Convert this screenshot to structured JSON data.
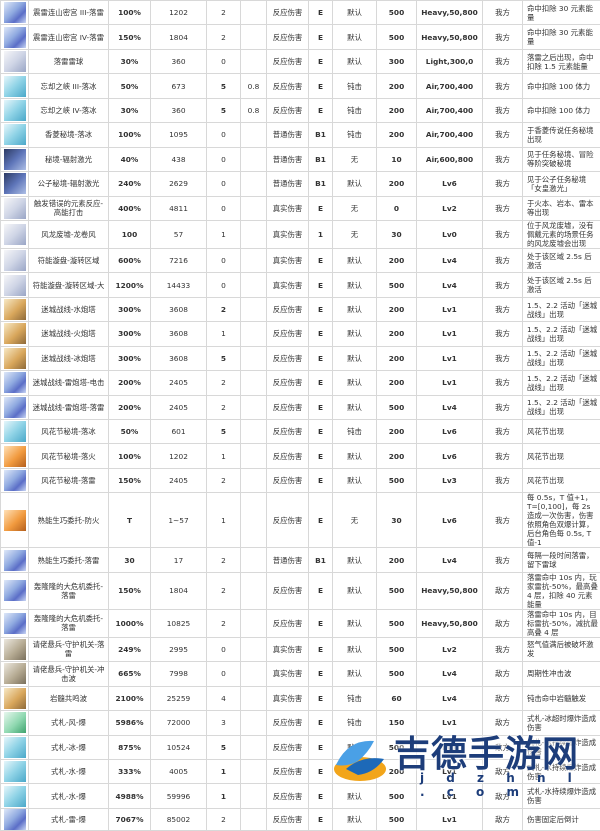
{
  "table": {
    "rows": [
      {
        "icon": "blue",
        "name": "震雷连山密宫 III-落雷",
        "pct": "100%",
        "val": "1202",
        "vc": "purple",
        "cnt": "2",
        "cc": "purple",
        "type": "反应伤害",
        "tc": "red",
        "ele": "E",
        "gauge": "默认",
        "dur": "500",
        "inf": "Heavy,50,800",
        "cat": "我方",
        "ci": "red",
        "desc": "命中扣除 30 元素能量"
      },
      {
        "icon": "blue",
        "name": "震雷连山密宫 IV-落雷",
        "pct": "150%",
        "val": "1804",
        "vc": "purple",
        "cnt": "2",
        "cc": "purple",
        "type": "反应伤害",
        "tc": "red",
        "ele": "E",
        "gauge": "默认",
        "dur": "500",
        "inf": "Heavy,50,800",
        "cat": "我方",
        "ci": "red",
        "desc": "命中扣除 30 元素能量"
      },
      {
        "icon": "white",
        "name": "落雷雷球",
        "pct": "30%",
        "val": "360",
        "vc": "purple",
        "cnt": "0",
        "cc": "purple",
        "type": "反应伤害",
        "tc": "red",
        "ele": "E",
        "gauge": "默认",
        "dur": "300",
        "inf": "Light,300,0",
        "cat": "我方",
        "ci": "red",
        "desc": "落雷之后出现，命中扣除 1.5 元素能量"
      },
      {
        "icon": "cyan",
        "name": "忘却之峡 III-落冰",
        "pct": "50%",
        "val": "673",
        "vc": "blue",
        "cnt": "5",
        "cc": "blue",
        "ins": "0.8",
        "type": "反应伤害",
        "tc": "red",
        "ele": "E",
        "gauge": "钝击",
        "dur": "200",
        "inf": "Air,700,400",
        "cat": "我方",
        "ci": "red",
        "desc": "命中扣除 100 体力"
      },
      {
        "icon": "cyan",
        "name": "忘却之峡 IV-落冰",
        "pct": "30%",
        "val": "360",
        "vc": "blue",
        "cnt": "5",
        "cc": "blue",
        "ins": "0.8",
        "type": "反应伤害",
        "tc": "red",
        "ele": "E",
        "gauge": "钝击",
        "dur": "200",
        "inf": "Air,700,400",
        "cat": "我方",
        "ci": "red",
        "desc": "命中扣除 100 体力"
      },
      {
        "icon": "cyan",
        "name": "香菱秘境-落冰",
        "pct": "100%",
        "val": "1095",
        "vc": "green",
        "cnt": "0",
        "cc": "green",
        "type": "普通伤害",
        "tc": "green",
        "ele": "B1",
        "gauge": "钝击",
        "dur": "200",
        "inf": "Air,700,400",
        "cat": "我方",
        "ci": "red",
        "desc": "于香菱传说任务秘境出现"
      },
      {
        "icon": "dark",
        "name": "秘境-辐射激光",
        "pct": "40%",
        "val": "438",
        "vc": "gray",
        "cnt": "0",
        "cc": "gray",
        "type": "普通伤害",
        "tc": "green",
        "ele": "B1",
        "gauge": "无",
        "dur": "10",
        "inf": "Air,600,800",
        "cat": "我方",
        "ci": "red",
        "desc": "见于任务秘境、冒险等阶突破秘境"
      },
      {
        "icon": "dark",
        "name": "公子秘境-辐射激光",
        "pct": "240%",
        "val": "2629",
        "vc": "gray",
        "cnt": "0",
        "cc": "gray",
        "type": "普通伤害",
        "tc": "green",
        "ele": "B1",
        "gauge": "默认",
        "dur": "200",
        "inf": "Lv6",
        "cat": "我方",
        "ci": "red",
        "desc": "见于公子任务秘境「女皇激光」"
      },
      {
        "icon": "white",
        "name": "触发错误的元素反应-高能打击",
        "pct": "400%",
        "val": "4811",
        "vc": "gray",
        "cnt": "0",
        "cc": "gray",
        "type": "真实伤害",
        "tc": "gray",
        "ele": "E",
        "gauge": "无",
        "dur": "0",
        "inf": "Lv2",
        "cat": "我方",
        "ci": "red",
        "desc": "于火本、岩本、雷本等出现"
      },
      {
        "icon": "white",
        "name": "风龙废墟-龙卷风",
        "pct": "100",
        "val": "57",
        "vc": "gray",
        "cnt": "1",
        "cc": "gray",
        "type": "真实伤害",
        "tc": "gray",
        "ele": "1",
        "gauge": "无",
        "dur": "30",
        "inf": "Lv0",
        "cat": "我方",
        "ci": "red",
        "desc": "位于风龙废墟，没有佩戴元素的场景任务的风龙废墟会出现"
      },
      {
        "icon": "white",
        "name": "符能漩盘-漩转区域",
        "pct": "600%",
        "val": "7216",
        "vc": "gray",
        "cnt": "0",
        "cc": "gray",
        "type": "真实伤害",
        "tc": "gray",
        "ele": "E",
        "gauge": "默认",
        "dur": "200",
        "inf": "Lv4",
        "cat": "我方",
        "ci": "red",
        "desc": "处于该区域 2.5s 后激活"
      },
      {
        "icon": "white",
        "name": "符能漩盘-漩转区域-大",
        "pct": "1200%",
        "val": "14433",
        "vc": "gray",
        "cnt": "0",
        "cc": "gray",
        "type": "真实伤害",
        "tc": "gray",
        "ele": "E",
        "gauge": "默认",
        "dur": "500",
        "inf": "Lv4",
        "cat": "我方",
        "ci": "red",
        "desc": "处于该区域 2.5s 后激活"
      },
      {
        "icon": "gold",
        "name": "迷城战线-水炮塔",
        "pct": "300%",
        "val": "3608",
        "vc": "blue",
        "cnt": "2",
        "cc": "blue",
        "type": "反应伤害",
        "tc": "red",
        "ele": "E",
        "gauge": "默认",
        "dur": "200",
        "inf": "Lv1",
        "cat": "我方",
        "ci": "red",
        "desc": "1.5、2.2 活动「迷城战线」出现"
      },
      {
        "icon": "gold",
        "name": "迷城战线-火炮塔",
        "pct": "300%",
        "val": "3608",
        "vc": "orange",
        "cnt": "1",
        "cc": "orange",
        "type": "反应伤害",
        "tc": "red",
        "ele": "E",
        "gauge": "默认",
        "dur": "200",
        "inf": "Lv1",
        "cat": "我方",
        "ci": "red",
        "desc": "1.5、2.2 活动「迷城战线」出现"
      },
      {
        "icon": "gold",
        "name": "迷城战线-冰炮塔",
        "pct": "300%",
        "val": "3608",
        "vc": "blue",
        "cnt": "5",
        "cc": "blue",
        "type": "反应伤害",
        "tc": "red",
        "ele": "E",
        "gauge": "默认",
        "dur": "200",
        "inf": "Lv1",
        "cat": "我方",
        "ci": "red",
        "desc": "1.5、2.2 活动「迷城战线」出现"
      },
      {
        "icon": "blue",
        "name": "迷城战线-雷炮塔-电击",
        "pct": "200%",
        "val": "2405",
        "vc": "purple",
        "cnt": "2",
        "cc": "purple",
        "type": "反应伤害",
        "tc": "red",
        "ele": "E",
        "gauge": "默认",
        "dur": "200",
        "inf": "Lv1",
        "cat": "我方",
        "ci": "red",
        "desc": "1.5、2.2 活动「迷城战线」出现"
      },
      {
        "icon": "blue",
        "name": "迷城战线-雷炮塔-落雷",
        "pct": "200%",
        "val": "2405",
        "vc": "purple",
        "cnt": "2",
        "cc": "purple",
        "type": "反应伤害",
        "tc": "red",
        "ele": "E",
        "gauge": "默认",
        "dur": "500",
        "inf": "Lv4",
        "cat": "我方",
        "ci": "red",
        "desc": "1.5、2.2 活动「迷城战线」出现"
      },
      {
        "icon": "cyan",
        "name": "风花节秘境-落冰",
        "pct": "50%",
        "val": "601",
        "vc": "blue",
        "cnt": "5",
        "cc": "blue",
        "type": "反应伤害",
        "tc": "red",
        "ele": "E",
        "gauge": "钝击",
        "dur": "200",
        "inf": "Lv6",
        "cat": "我方",
        "ci": "red",
        "desc": "风花节出现"
      },
      {
        "icon": "orange",
        "name": "风花节秘境-落火",
        "pct": "100%",
        "val": "1202",
        "vc": "orange",
        "cnt": "1",
        "cc": "orange",
        "type": "反应伤害",
        "tc": "red",
        "ele": "E",
        "gauge": "默认",
        "dur": "200",
        "inf": "Lv6",
        "cat": "我方",
        "ci": "red",
        "desc": "风花节出现"
      },
      {
        "icon": "blue",
        "name": "风花节秘境-落雷",
        "pct": "150%",
        "val": "2405",
        "vc": "purple",
        "cnt": "2",
        "cc": "purple",
        "type": "反应伤害",
        "tc": "red",
        "ele": "E",
        "gauge": "默认",
        "dur": "500",
        "inf": "Lv3",
        "cat": "我方",
        "ci": "red",
        "desc": "风花节出现"
      },
      {
        "icon": "orange",
        "name": "熟能生巧委托-防火",
        "pct": "T",
        "val": "1~57",
        "vc": "orange",
        "cnt": "1",
        "cc": "orange",
        "type": "反应伤害",
        "tc": "red",
        "ele": "E",
        "gauge": "无",
        "dur": "30",
        "inf": "Lv6",
        "cat": "我方",
        "ci": "red",
        "desc": "每 0.5s，T 值+1，T=[0,100]，每 2s 造成一次伤害，伤害依照角色双爆计算，后台角色每 0.5s, T 值-1"
      },
      {
        "icon": "blue",
        "name": "熟能生巧委托-落雷",
        "pct": "30",
        "val": "17",
        "vc": "purple",
        "cnt": "2",
        "cc": "purple",
        "type": "普通伤害",
        "tc": "green",
        "ele": "B1",
        "gauge": "默认",
        "dur": "200",
        "inf": "Lv4",
        "cat": "我方",
        "ci": "red",
        "desc": "每隔一段时间落雷，留下雷球"
      },
      {
        "icon": "blue",
        "name": "轰隆隆的大危机委托-落雷",
        "pct": "150%",
        "val": "1804",
        "vc": "purple",
        "cnt": "2",
        "cc": "purple",
        "type": "反应伤害",
        "tc": "red",
        "ele": "E",
        "gauge": "默认",
        "dur": "500",
        "inf": "Heavy,50,800",
        "cat": "敌方",
        "ci": "green",
        "desc": "落雷命中 10s 内，玩家雷抗-50%，最高叠 4 层，扣除 40 元素能量"
      },
      {
        "icon": "blue",
        "name": "轰隆隆的大危机委托-落雷",
        "pct": "1000%",
        "val": "10825",
        "vc": "purple",
        "cnt": "2",
        "cc": "purple",
        "type": "反应伤害",
        "tc": "red",
        "ele": "E",
        "gauge": "默认",
        "dur": "500",
        "inf": "Heavy,50,800",
        "cat": "敌方",
        "ci": "green",
        "desc": "落雷命中 10s 内，目标雷抗-50%，减抗最高叠 4 层"
      },
      {
        "icon": "stone",
        "name": "请佬悬兵-守护机关-落雷",
        "pct": "249%",
        "val": "2995",
        "vc": "gray",
        "cnt": "0",
        "cc": "gray",
        "type": "真实伤害",
        "tc": "gray",
        "ele": "E",
        "gauge": "默认",
        "dur": "500",
        "inf": "Lv2",
        "cat": "我方",
        "ci": "red",
        "desc": "怒气值满后被破坏激发"
      },
      {
        "icon": "stone",
        "name": "请佬悬兵-守护机关-冲击波",
        "pct": "665%",
        "val": "7998",
        "vc": "gray",
        "cnt": "0",
        "cc": "gray",
        "type": "真实伤害",
        "tc": "gray",
        "ele": "E",
        "gauge": "默认",
        "dur": "500",
        "inf": "Lv4",
        "cat": "敌方",
        "ci": "green",
        "desc": "周期性冲击波"
      },
      {
        "icon": "gold",
        "name": "岩髓共鸣波",
        "pct": "2100%",
        "val": "25259",
        "vc": "gold",
        "cnt": "4",
        "cc": "gold",
        "type": "真实伤害",
        "tc": "gray",
        "ele": "E",
        "gauge": "钝击",
        "dur": "60",
        "inf": "Lv4",
        "cat": "敌方",
        "ci": "green",
        "desc": "钝击命中岩髓触发"
      },
      {
        "icon": "green",
        "name": "式札-风-爆",
        "pct": "5986%",
        "val": "72000",
        "vc": "green",
        "cnt": "3",
        "cc": "green",
        "type": "反应伤害",
        "tc": "red",
        "ele": "E",
        "gauge": "钝击",
        "dur": "150",
        "inf": "Lv1",
        "cat": "敌方",
        "ci": "green",
        "desc": "式札-冰超时爆炸造成伤害"
      },
      {
        "icon": "cyan",
        "name": "式札-冰-爆",
        "pct": "875%",
        "val": "10524",
        "vc": "blue",
        "cnt": "5",
        "cc": "blue",
        "type": "反应伤害",
        "tc": "red",
        "ele": "E",
        "gauge": "默认",
        "dur": "500",
        "inf": "Lv1",
        "cat": "敌方",
        "ci": "green",
        "desc": "式札-冰持续爆炸造成伤害"
      },
      {
        "icon": "cyan",
        "name": "式札-水-爆",
        "pct": "333%",
        "val": "4005",
        "vc": "blue",
        "cnt": "1",
        "cc": "blue",
        "type": "反应伤害",
        "tc": "red",
        "ele": "E",
        "gauge": "默认",
        "dur": "200",
        "inf": "Lv1",
        "cat": "敌方",
        "ci": "green",
        "desc": "式札-水持续爆炸造成伤害"
      },
      {
        "icon": "cyan",
        "name": "式札-水-爆",
        "pct": "4988%",
        "val": "59996",
        "vc": "purple",
        "cnt": "1",
        "cc": "blue",
        "type": "反应伤害",
        "tc": "red",
        "ele": "E",
        "gauge": "默认",
        "dur": "500",
        "inf": "Lv1",
        "cat": "敌方",
        "ci": "green",
        "desc": "式札-水持续爆炸造成伤害"
      },
      {
        "icon": "blue",
        "name": "式札-雷-爆",
        "pct": "7067%",
        "val": "85002",
        "vc": "purple",
        "cnt": "2",
        "cc": "purple",
        "type": "反应伤害",
        "tc": "red",
        "ele": "E",
        "gauge": "默认",
        "dur": "500",
        "inf": "Lv1",
        "cat": "敌方",
        "ci": "green",
        "desc": "伤害固定后倒计"
      }
    ]
  },
  "watermark": {
    "brand": "吉德手游网",
    "domain": "j d z h n l . c o m"
  }
}
